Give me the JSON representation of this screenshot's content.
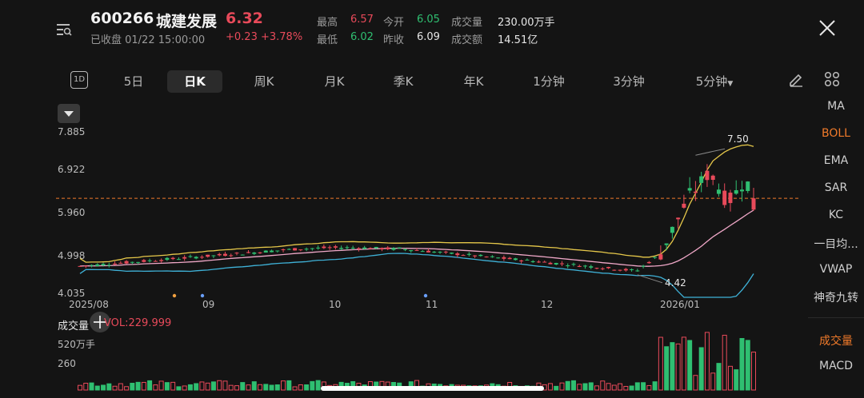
{
  "header": {
    "code": "600266",
    "name": "城建发展",
    "price": "6.32",
    "status": "已收盘 01/22 15:00:00",
    "change": "+0.23",
    "change_pct": "+3.78%",
    "quotes": [
      {
        "label": "最高",
        "value": "6.57",
        "color": "#e84a5a"
      },
      {
        "label": "今开",
        "value": "6.05",
        "color": "#2fbf71"
      },
      {
        "label": "成交量",
        "value": "230.00万手",
        "color": "#e6e6e6"
      },
      {
        "label": "最低",
        "value": "6.02",
        "color": "#2fbf71"
      },
      {
        "label": "昨收",
        "value": "6.09",
        "color": "#e6e6e6"
      },
      {
        "label": "成交额",
        "value": "14.51亿",
        "color": "#e6e6e6"
      }
    ]
  },
  "tabs": [
    "1D",
    "5日",
    "日K",
    "周K",
    "月K",
    "季K",
    "年K",
    "1分钟",
    "3分钟",
    "5分钟"
  ],
  "active_tab": "日K",
  "indicators": [
    "MA",
    "BOLL",
    "EMA",
    "SAR",
    "KC",
    "一目均...",
    "VWAP",
    "神奇九转",
    "成交量",
    "MACD"
  ],
  "active_indicators": [
    "BOLL",
    "成交量"
  ],
  "icons": {
    "close": "close-icon",
    "draw": "pencil-icon",
    "grid": "grid-icon",
    "dropdown": "chevron-down-icon",
    "crosshair": "crosshair-icon"
  },
  "colors": {
    "up": "#e84a5a",
    "down": "#2fbf71",
    "boll_upper": "#e6c84a",
    "boll_mid": "#f0a8c8",
    "boll_lower": "#3fb2d8",
    "last_price_line": "#f07a2a"
  },
  "chart_data": {
    "type": "candlestick",
    "y_ticks": [
      "7.885",
      "6.922",
      "5.960",
      "4.998",
      "4.035"
    ],
    "x_labels": [
      "2025/08",
      "09",
      "10",
      "11",
      "12",
      "2026/01"
    ],
    "high_label": "7.50",
    "low_label": "4.42",
    "last_price": 6.32,
    "volume_label": "成交量",
    "volume_value": "VOL:229.999",
    "volume_ticks": [
      "520万手",
      "260"
    ]
  }
}
